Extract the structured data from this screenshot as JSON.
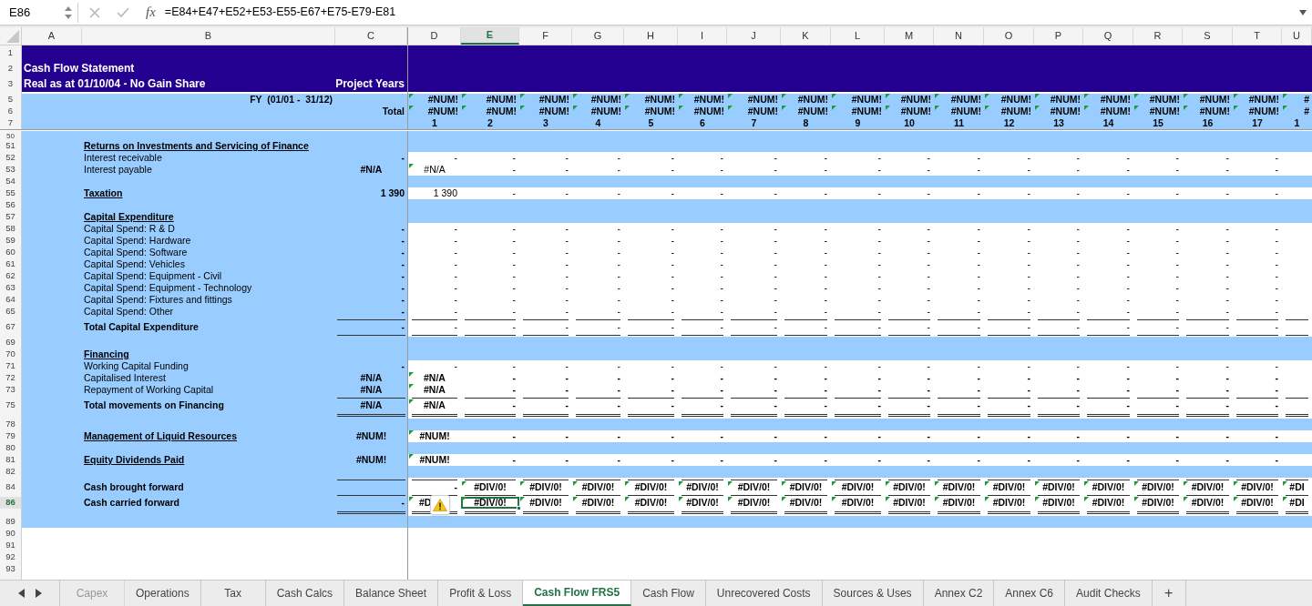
{
  "formula_bar": {
    "name_box": "E86",
    "function_label": "fx",
    "formula": "=E84+E47+E52+E53-E55-E67+E75-E79-E81"
  },
  "columns": [
    {
      "letter": "A",
      "selected": false
    },
    {
      "letter": "B",
      "selected": false
    },
    {
      "letter": "C",
      "selected": false
    },
    {
      "letter": "D",
      "selected": false
    },
    {
      "letter": "E",
      "selected": true
    },
    {
      "letter": "F",
      "selected": false
    },
    {
      "letter": "G",
      "selected": false
    },
    {
      "letter": "H",
      "selected": false
    },
    {
      "letter": "I",
      "selected": false
    },
    {
      "letter": "J",
      "selected": false
    },
    {
      "letter": "K",
      "selected": false
    },
    {
      "letter": "L",
      "selected": false
    },
    {
      "letter": "M",
      "selected": false
    },
    {
      "letter": "N",
      "selected": false
    },
    {
      "letter": "O",
      "selected": false
    },
    {
      "letter": "P",
      "selected": false
    },
    {
      "letter": "Q",
      "selected": false
    },
    {
      "letter": "R",
      "selected": false
    },
    {
      "letter": "S",
      "selected": false
    },
    {
      "letter": "T",
      "selected": false
    },
    {
      "letter": "U",
      "selected": false
    }
  ],
  "rows": [
    {
      "number": "1",
      "kind": "title",
      "selected": false
    },
    {
      "number": "2",
      "kind": "title",
      "label": "Cash Flow Statement",
      "selected": false
    },
    {
      "number": "3",
      "kind": "title",
      "label": "Real as at 01/10/04 - No Gain Share",
      "total": "Project Years",
      "selected": false
    },
    {
      "kind": "gap",
      "selected": false
    },
    {
      "number": "5",
      "kind": "header",
      "label": "FY  (01/01 -  31/12)",
      "values": [
        "#NUM!",
        "#NUM!",
        "#NUM!",
        "#NUM!",
        "#NUM!",
        "#NUM!",
        "#NUM!",
        "#NUM!",
        "#NUM!",
        "#NUM!",
        "#NUM!",
        "#NUM!",
        "#NUM!",
        "#NUM!",
        "#NUM!",
        "#NUM!",
        "#NUM!",
        "#"
      ],
      "flags": [
        true,
        true,
        true,
        true,
        true,
        true,
        true,
        true,
        true,
        true,
        true,
        true,
        true,
        true,
        true,
        true,
        true,
        true
      ],
      "selected": false
    },
    {
      "number": "6",
      "kind": "header",
      "total": "Total",
      "values": [
        "#NUM!",
        "#NUM!",
        "#NUM!",
        "#NUM!",
        "#NUM!",
        "#NUM!",
        "#NUM!",
        "#NUM!",
        "#NUM!",
        "#NUM!",
        "#NUM!",
        "#NUM!",
        "#NUM!",
        "#NUM!",
        "#NUM!",
        "#NUM!",
        "#NUM!",
        "#"
      ],
      "flags": [
        true,
        true,
        true,
        true,
        true,
        true,
        true,
        true,
        true,
        true,
        true,
        true,
        true,
        true,
        true,
        true,
        true,
        true
      ],
      "selected": false
    },
    {
      "number": "7",
      "kind": "years",
      "values": [
        "1",
        "2",
        "3",
        "4",
        "5",
        "6",
        "7",
        "8",
        "9",
        "10",
        "11",
        "12",
        "13",
        "14",
        "15",
        "16",
        "17",
        "1"
      ],
      "selected": false
    },
    {
      "number": "50",
      "kind": "cut_band",
      "selected": false
    },
    {
      "number": "51",
      "kind": "band",
      "label": "Returns on Investments and Servicing of Finance",
      "label_bold": true,
      "label_underlined": true,
      "selected": false
    },
    {
      "number": "52",
      "kind": "data",
      "label": "Interest receivable",
      "label_bold": false,
      "label_underlined": false,
      "total": "-",
      "values": [
        "-",
        "-",
        "-",
        "-",
        "-",
        "-",
        "-",
        "-",
        "-",
        "-",
        "-",
        "-",
        "-",
        "-",
        "-",
        "-",
        "-"
      ],
      "selected": false
    },
    {
      "number": "53",
      "kind": "data",
      "label": "Interest payable",
      "label_bold": false,
      "label_underlined": false,
      "total": "#N/A",
      "total_error": true,
      "values": [
        "#N/A",
        "-",
        "-",
        "-",
        "-",
        "-",
        "-",
        "-",
        "-",
        "-",
        "-",
        "-",
        "-",
        "-",
        "-",
        "-",
        "-"
      ],
      "flags": [
        true
      ],
      "selected": false
    },
    {
      "number": "54",
      "kind": "band",
      "selected": false
    },
    {
      "number": "55",
      "kind": "data",
      "label": "Taxation",
      "label_bold": true,
      "label_underlined": true,
      "total": "1 390",
      "values": [
        "1 390",
        "-",
        "-",
        "-",
        "-",
        "-",
        "-",
        "-",
        "-",
        "-",
        "-",
        "-",
        "-",
        "-",
        "-",
        "-",
        "-"
      ],
      "selected": false
    },
    {
      "number": "56",
      "kind": "band",
      "selected": false
    },
    {
      "number": "57",
      "kind": "band",
      "label": "Capital Expenditure",
      "label_bold": true,
      "label_underlined": true,
      "selected": false
    },
    {
      "number": "58",
      "kind": "data",
      "label": "Capital Spend: R & D",
      "label_bold": false,
      "label_underlined": false,
      "total": "-",
      "values": [
        "-",
        "-",
        "-",
        "-",
        "-",
        "-",
        "-",
        "-",
        "-",
        "-",
        "-",
        "-",
        "-",
        "-",
        "-",
        "-",
        "-"
      ],
      "selected": false
    },
    {
      "number": "59",
      "kind": "data",
      "label": "Capital Spend: Hardware",
      "label_bold": false,
      "label_underlined": false,
      "total": "-",
      "values": [
        "-",
        "-",
        "-",
        "-",
        "-",
        "-",
        "-",
        "-",
        "-",
        "-",
        "-",
        "-",
        "-",
        "-",
        "-",
        "-",
        "-"
      ],
      "selected": false
    },
    {
      "number": "60",
      "kind": "data",
      "label": "Capital Spend: Software",
      "label_bold": false,
      "label_underlined": false,
      "total": "-",
      "values": [
        "-",
        "-",
        "-",
        "-",
        "-",
        "-",
        "-",
        "-",
        "-",
        "-",
        "-",
        "-",
        "-",
        "-",
        "-",
        "-",
        "-"
      ],
      "selected": false
    },
    {
      "number": "61",
      "kind": "data",
      "label": "Capital Spend: Vehicles",
      "label_bold": false,
      "label_underlined": false,
      "total": "-",
      "values": [
        "-",
        "-",
        "-",
        "-",
        "-",
        "-",
        "-",
        "-",
        "-",
        "-",
        "-",
        "-",
        "-",
        "-",
        "-",
        "-",
        "-"
      ],
      "selected": false
    },
    {
      "number": "62",
      "kind": "data",
      "label": "Capital Spend: Equipment - Civil",
      "label_bold": false,
      "label_underlined": false,
      "total": "-",
      "values": [
        "-",
        "-",
        "-",
        "-",
        "-",
        "-",
        "-",
        "-",
        "-",
        "-",
        "-",
        "-",
        "-",
        "-",
        "-",
        "-",
        "-"
      ],
      "selected": false
    },
    {
      "number": "63",
      "kind": "data",
      "label": "Capital Spend: Equipment - Technology",
      "label_bold": false,
      "label_underlined": false,
      "total": "-",
      "values": [
        "-",
        "-",
        "-",
        "-",
        "-",
        "-",
        "-",
        "-",
        "-",
        "-",
        "-",
        "-",
        "-",
        "-",
        "-",
        "-",
        "-"
      ],
      "selected": false
    },
    {
      "number": "64",
      "kind": "data",
      "label": "Capital Spend: Fixtures and fittings",
      "label_bold": false,
      "label_underlined": false,
      "total": "-",
      "values": [
        "-",
        "-",
        "-",
        "-",
        "-",
        "-",
        "-",
        "-",
        "-",
        "-",
        "-",
        "-",
        "-",
        "-",
        "-",
        "-",
        "-"
      ],
      "selected": false
    },
    {
      "number": "65",
      "kind": "data",
      "label": "Capital Spend: Other",
      "label_bold": false,
      "label_underlined": false,
      "total": "-",
      "values": [
        "-",
        "-",
        "-",
        "-",
        "-",
        "-",
        "-",
        "-",
        "-",
        "-",
        "-",
        "-",
        "-",
        "-",
        "-",
        "-",
        "-"
      ],
      "selected": false
    },
    {
      "kind": "rule",
      "selected": false
    },
    {
      "number": "67",
      "kind": "data",
      "label": "Total Capital Expenditure",
      "label_bold": true,
      "label_underlined": false,
      "total": "-",
      "values": [
        "-",
        "-",
        "-",
        "-",
        "-",
        "-",
        "-",
        "-",
        "-",
        "-",
        "-",
        "-",
        "-",
        "-",
        "-",
        "-",
        "-"
      ],
      "selected": false
    },
    {
      "kind": "rule",
      "selected": false
    },
    {
      "number": "69",
      "kind": "band",
      "selected": false
    },
    {
      "number": "70",
      "kind": "band",
      "label": "Financing",
      "label_bold": true,
      "label_underlined": true,
      "selected": false
    },
    {
      "number": "71",
      "kind": "data",
      "label": "Working Capital Funding",
      "label_bold": false,
      "label_underlined": false,
      "total": "-",
      "values": [
        "-",
        "-",
        "-",
        "-",
        "-",
        "-",
        "-",
        "-",
        "-",
        "-",
        "-",
        "-",
        "-",
        "-",
        "-",
        "-",
        "-"
      ],
      "selected": false
    },
    {
      "number": "72",
      "kind": "data",
      "label": "Capitalised Interest",
      "label_bold": false,
      "label_underlined": false,
      "total": "#N/A",
      "total_error": true,
      "values": [
        "#N/A",
        "-",
        "-",
        "-",
        "-",
        "-",
        "-",
        "-",
        "-",
        "-",
        "-",
        "-",
        "-",
        "-",
        "-",
        "-",
        "-"
      ],
      "flags": [
        true
      ],
      "bold": true,
      "selected": false
    },
    {
      "number": "73",
      "kind": "data",
      "label": "Repayment of Working Capital",
      "label_bold": false,
      "label_underlined": false,
      "total": "#N/A",
      "total_error": true,
      "values": [
        "#N/A",
        "-",
        "-",
        "-",
        "-",
        "-",
        "-",
        "-",
        "-",
        "-",
        "-",
        "-",
        "-",
        "-",
        "-",
        "-",
        "-"
      ],
      "flags": [
        true
      ],
      "bold": true,
      "selected": false
    },
    {
      "kind": "rule",
      "selected": false
    },
    {
      "number": "75",
      "kind": "data",
      "label": "Total movements on Financing",
      "label_bold": true,
      "label_underlined": false,
      "total": "#N/A",
      "total_error": true,
      "values": [
        "#N/A",
        "-",
        "-",
        "-",
        "-",
        "-",
        "-",
        "-",
        "-",
        "-",
        "-",
        "-",
        "-",
        "-",
        "-",
        "-",
        "-"
      ],
      "flags": [
        true
      ],
      "bold": true,
      "selected": false
    },
    {
      "kind": "double_rule",
      "selected": false
    },
    {
      "number": "78",
      "kind": "band",
      "selected": false
    },
    {
      "number": "79",
      "kind": "data",
      "label": "Management of Liquid Resources",
      "label_bold": true,
      "label_underlined": true,
      "total": "#NUM!",
      "total_error": true,
      "values": [
        "#NUM!",
        "-",
        "-",
        "-",
        "-",
        "-",
        "-",
        "-",
        "-",
        "-",
        "-",
        "-",
        "-",
        "-",
        "-",
        "-",
        "-"
      ],
      "flags": [
        true
      ],
      "bold": true,
      "selected": false
    },
    {
      "number": "80",
      "kind": "band",
      "selected": false
    },
    {
      "number": "81",
      "kind": "data",
      "label": "Equity Dividends Paid",
      "label_bold": true,
      "label_underlined": true,
      "total": "#NUM!",
      "total_error": true,
      "values": [
        "#NUM!",
        "-",
        "-",
        "-",
        "-",
        "-",
        "-",
        "-",
        "-",
        "-",
        "-",
        "-",
        "-",
        "-",
        "-",
        "-",
        "-"
      ],
      "flags": [
        true
      ],
      "bold": true,
      "selected": false
    },
    {
      "number": "82",
      "kind": "band",
      "selected": false
    },
    {
      "kind": "rule",
      "selected": false
    },
    {
      "number": "84",
      "kind": "data",
      "label": "Cash brought forward",
      "label_bold": true,
      "label_underlined": false,
      "values": [
        "-",
        "#DIV/0!",
        "#DIV/0!",
        "#DIV/0!",
        "#DIV/0!",
        "#DIV/0!",
        "#DIV/0!",
        "#DIV/0!",
        "#DIV/0!",
        "#DIV/0!",
        "#DIV/0!",
        "#DIV/0!",
        "#DIV/0!",
        "#DIV/0!",
        "#DIV/0!",
        "#DIV/0!",
        "#DIV/0!",
        "#DI"
      ],
      "flags": [
        false,
        true,
        true,
        true,
        true,
        true,
        true,
        true,
        true,
        true,
        true,
        true,
        true,
        true,
        true,
        true,
        true,
        true
      ],
      "bold": true,
      "selected": false
    },
    {
      "kind": "rule",
      "selected": false
    },
    {
      "number": "86",
      "kind": "data",
      "label": "Cash carried forward",
      "label_bold": true,
      "label_underlined": false,
      "total": "-",
      "values": [
        "#D",
        "#DIV/0!",
        "#DIV/0!",
        "#DIV/0!",
        "#DIV/0!",
        "#DIV/0!",
        "#DIV/0!",
        "#DIV/0!",
        "#DIV/0!",
        "#DIV/0!",
        "#DIV/0!",
        "#DIV/0!",
        "#DIV/0!",
        "#DIV/0!",
        "#DIV/0!",
        "#DIV/0!",
        "#DIV/0!",
        "#DI"
      ],
      "flags": [
        true,
        true,
        true,
        true,
        true,
        true,
        true,
        true,
        true,
        true,
        true,
        true,
        true,
        true,
        true,
        true,
        true,
        true
      ],
      "bold": true,
      "warning": true,
      "selected": true
    },
    {
      "kind": "double_rule",
      "selected": false
    },
    {
      "number": "89",
      "kind": "band",
      "selected": false
    },
    {
      "number": "90",
      "kind": "blank",
      "selected": false
    },
    {
      "number": "91",
      "kind": "blank",
      "selected": false
    },
    {
      "number": "92",
      "kind": "blank",
      "selected": false
    },
    {
      "number": "93",
      "kind": "blank",
      "selected": false
    },
    {
      "kind": "cut_blank",
      "selected": false
    }
  ],
  "sheet_tabs": [
    {
      "label": "Capex",
      "selected": false,
      "dimmed": true
    },
    {
      "label": "Operations",
      "selected": false,
      "dimmed": false
    },
    {
      "label": "Tax",
      "selected": false,
      "dimmed": false
    },
    {
      "label": "Cash Calcs",
      "selected": false,
      "dimmed": false
    },
    {
      "label": "Balance Sheet",
      "selected": false,
      "dimmed": false
    },
    {
      "label": "Profit & Loss",
      "selected": false,
      "dimmed": false
    },
    {
      "label": "Cash Flow FRS5",
      "selected": true,
      "dimmed": false
    },
    {
      "label": "Cash Flow",
      "selected": false,
      "dimmed": false
    },
    {
      "label": "Unrecovered Costs",
      "selected": false,
      "dimmed": false
    },
    {
      "label": "Sources & Uses",
      "selected": false,
      "dimmed": false
    },
    {
      "label": "Annex C2",
      "selected": false,
      "dimmed": false
    },
    {
      "label": "Annex C6",
      "selected": false,
      "dimmed": false
    },
    {
      "label": "Audit Checks",
      "selected": false,
      "dimmed": false
    }
  ],
  "add_sheet": "+"
}
